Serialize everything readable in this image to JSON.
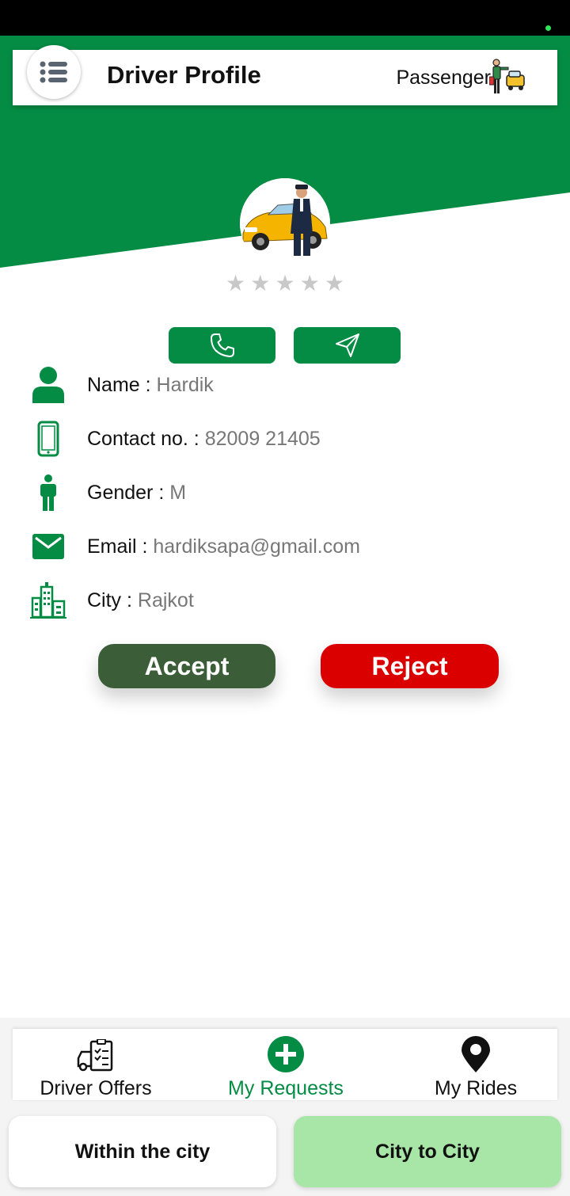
{
  "header": {
    "title": "Driver Profile",
    "passenger_label": "Passenger"
  },
  "profile": {
    "rating": 0,
    "rating_max": 5,
    "fields": [
      {
        "label": "Name : ",
        "value": "Hardik"
      },
      {
        "label": "Contact no. : ",
        "value": " 82009 21405"
      },
      {
        "label": "Gender : ",
        "value": "M"
      },
      {
        "label": "Email : ",
        "value": "hardiksapa@gmail.com"
      },
      {
        "label": "City : ",
        "value": "Rajkot"
      }
    ]
  },
  "actions": {
    "accept": "Accept",
    "reject": "Reject"
  },
  "bottom_nav": {
    "items": [
      {
        "label": "Driver Offers",
        "icon": "driver-offers-icon"
      },
      {
        "label": "My Requests",
        "icon": "add-circle-icon"
      },
      {
        "label": "My Rides",
        "icon": "map-pin-icon"
      }
    ],
    "active_index": 1
  },
  "tabs": {
    "within_city": "Within the city",
    "city_to_city": "City to City"
  },
  "colors": {
    "brand_green": "#048c44",
    "accept": "#3b5e39",
    "reject": "#db0000",
    "tab_active": "#a8e6a8"
  }
}
